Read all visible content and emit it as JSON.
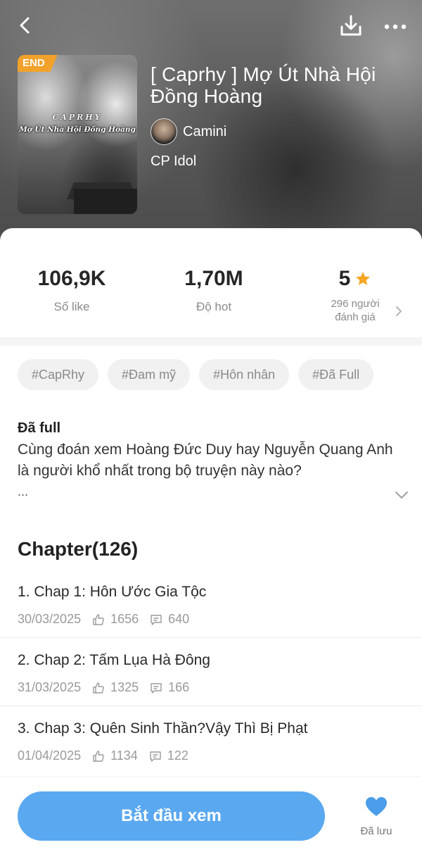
{
  "header": {
    "icons": {
      "back": "chevron-left-icon",
      "download": "download-icon",
      "more": "more-dots-icon"
    }
  },
  "book": {
    "badge": "END",
    "cover_text_line1": "CAPRHY",
    "cover_text_line2": "Mợ Út Nhà Hội Đồng Hoàng",
    "title": "[ Caprhy ] Mợ Út Nhà Hội Đồng Hoàng",
    "author": "Camini",
    "category": "CP Idol"
  },
  "stats": {
    "likes": {
      "value": "106,9K",
      "label": "Số like"
    },
    "hot": {
      "value": "1,70M",
      "label": "Độ hot"
    },
    "rating": {
      "value": "5",
      "sub_line1": "296 người",
      "sub_line2": "đánh giá"
    },
    "star_color": "#f5a623"
  },
  "tags": [
    "#CapRhy",
    "#Đam mỹ",
    "#Hôn nhân",
    "#Đã Full"
  ],
  "description": {
    "status": "Đã full",
    "text": "Cùng đoán xem Hoàng Đức Duy hay Nguyễn Quang Anh là người khổ nhất trong bộ truyện này nào?",
    "more": "..."
  },
  "chapters": {
    "heading": "Chapter(126)",
    "items": [
      {
        "name": "1. Chap 1: Hôn Ước Gia Tộc",
        "date": "30/03/2025",
        "likes": "1656",
        "comments": "640"
      },
      {
        "name": "2. Chap 2: Tấm Lụa Hà Đông",
        "date": "31/03/2025",
        "likes": "1325",
        "comments": "166"
      },
      {
        "name": "3. Chap 3: Quên Sinh Thần?Vậy Thì Bị Phạt",
        "date": "01/04/2025",
        "likes": "1134",
        "comments": "122"
      }
    ]
  },
  "bottom": {
    "start_label": "Bắt đầu xem",
    "save_label": "Đã lưu",
    "accent": "#5aa8f0"
  }
}
